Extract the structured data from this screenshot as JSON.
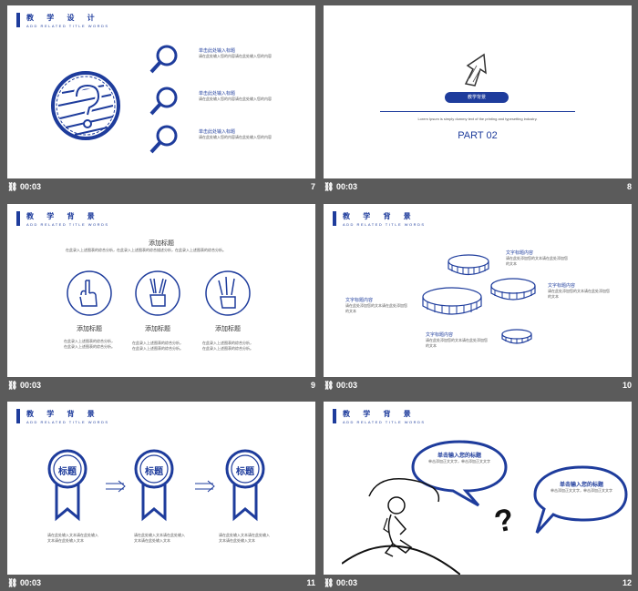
{
  "header": {
    "title": "教 学 设 计",
    "title2": "教 学 背 景",
    "subtitle": "ADD RELATED TITLE WORDS"
  },
  "timestamp": "00:03",
  "slides": {
    "s7": {
      "num": "7",
      "items": [
        {
          "title": "单击此处输入标题",
          "text": "请在此处输入您的内容请在此处输入您的内容"
        },
        {
          "title": "单击此处输入标题",
          "text": "请在此处输入您的内容请在此处输入您的内容"
        },
        {
          "title": "单击此处输入标题",
          "text": "请在此处输入您的内容请在此处输入您的内容"
        }
      ]
    },
    "s8": {
      "num": "8",
      "button": "教学背景",
      "desc": "Lorem Ipsum is simply dummy text of the printing and typesetting industry.",
      "part": "PART 02"
    },
    "s9": {
      "num": "9",
      "title": "添加标题",
      "desc": "在此录入上述图表的综合分析，在此录入上述图表的综合描述分析，在此录入上述图表的综合分析。",
      "items": [
        {
          "title": "添加标题",
          "text": "在此录入上述图表的综合分析，在此录入上述图表的综合分析。"
        },
        {
          "title": "添加标题",
          "text": "在此录入上述图表的综合分析，在此录入上述图表的综合分析。"
        },
        {
          "title": "添加标题",
          "text": "在此录入上述图表的综合分析，在此录入上述图表的综合分析。"
        }
      ]
    },
    "s10": {
      "num": "10",
      "labels": [
        {
          "title": "文字标题内容",
          "text": "请在此处添加您的文本请在此处添加您的文本"
        },
        {
          "title": "文字标题内容",
          "text": "请在此处添加您的文本请在此处添加您的文本"
        },
        {
          "title": "文字标题内容",
          "text": "请在此处添加您的文本请在此处添加您的文本"
        },
        {
          "title": "文字标题内容",
          "text": "请在此处添加您的文本请在此处添加您的文本"
        }
      ]
    },
    "s11": {
      "num": "11",
      "medal": "标题",
      "items": [
        {
          "text": "请在此处输入文本请在此处输入文本请在此处输入文本"
        },
        {
          "text": "请在此处输入文本请在此处输入文本请在此处输入文本"
        },
        {
          "text": "请在此处输入文本请在此处输入文本请在此处输入文本"
        }
      ]
    },
    "s12": {
      "num": "12",
      "bubbles": [
        {
          "title": "单击输入您的标题",
          "text": "单击添加正文文字，单击添加正文文字"
        },
        {
          "title": "单击输入您的标题",
          "text": "单击添加正文文字，单击添加正文文字"
        }
      ],
      "mark": "?"
    }
  },
  "colors": {
    "accent": "#1e3c9c"
  }
}
